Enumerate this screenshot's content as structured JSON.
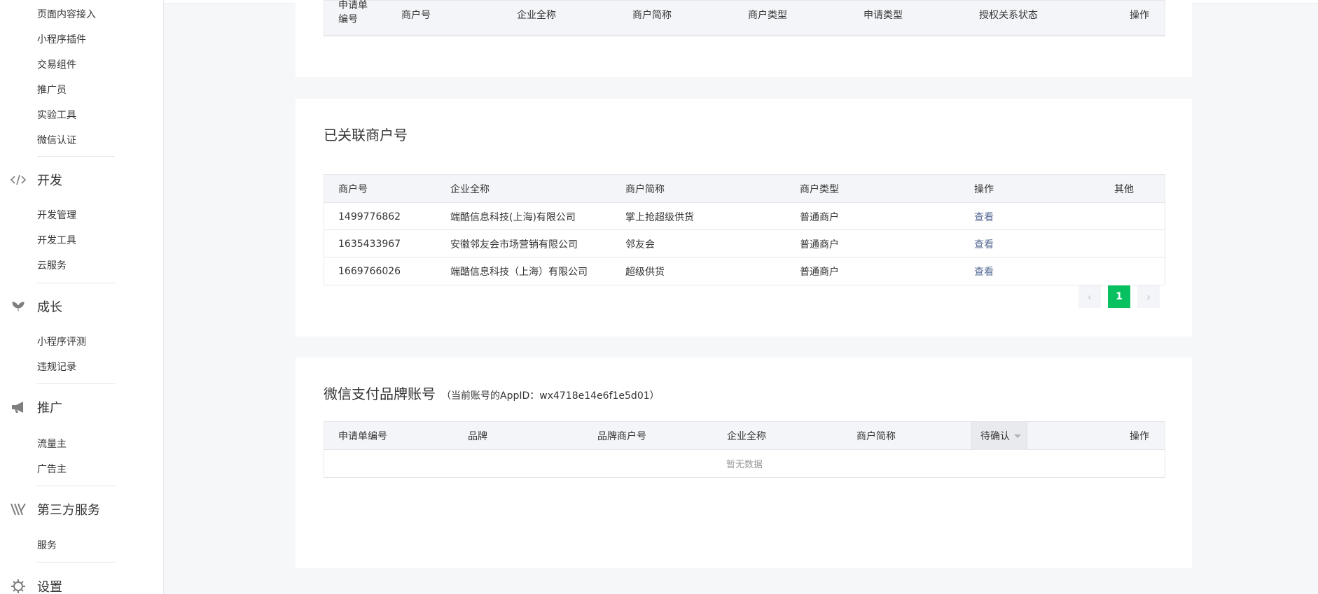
{
  "sidebar": {
    "top_items": [
      "页面内容接入",
      "小程序插件",
      "交易组件",
      "推广员",
      "实验工具",
      "微信认证"
    ],
    "groups": [
      {
        "label": "开发",
        "icon": "code-icon",
        "items": [
          "开发管理",
          "开发工具",
          "云服务"
        ]
      },
      {
        "label": "成长",
        "icon": "sprout-icon",
        "items": [
          "小程序评测",
          "违规记录"
        ]
      },
      {
        "label": "推广",
        "icon": "megaphone-icon",
        "items": [
          "流量主",
          "广告主"
        ]
      },
      {
        "label": "第三方服务",
        "icon": "third-party-icon",
        "items": [
          "服务"
        ]
      },
      {
        "label": "设置",
        "icon": "gear-icon",
        "items": []
      }
    ]
  },
  "apply_table": {
    "headers": [
      "申请单编号",
      "商户号",
      "企业全称",
      "商户简称",
      "商户类型",
      "申请类型",
      "授权关系状态",
      "操作"
    ]
  },
  "linked": {
    "title": "已关联商户号",
    "headers": [
      "商户号",
      "企业全称",
      "商户简称",
      "商户类型",
      "操作",
      "其他"
    ],
    "rows": [
      {
        "id": "1499776862",
        "company": "端酷信息科技(上海)有限公司",
        "short": "掌上抢超级供货",
        "type": "普通商户",
        "action": "查看"
      },
      {
        "id": "1635433967",
        "company": "安徽邻友会市场营销有限公司",
        "short": "邻友会",
        "type": "普通商户",
        "action": "查看"
      },
      {
        "id": "1669766026",
        "company": "端酷信息科技（上海）有限公司",
        "short": "超级供货",
        "type": "普通商户",
        "action": "查看"
      }
    ],
    "pager": {
      "prev": "‹",
      "current": "1",
      "next": "›"
    }
  },
  "brand": {
    "title": "微信支付品牌账号",
    "subtitle": "（当前账号的AppID：wx4718e14e6f1e5d01）",
    "headers": [
      "申请单编号",
      "品牌",
      "品牌商户号",
      "企业全称",
      "商户简称",
      "操作"
    ],
    "status_select": "待确认",
    "empty": "暂无数据"
  },
  "colors": {
    "accent": "#07c160",
    "link": "#576b95"
  }
}
